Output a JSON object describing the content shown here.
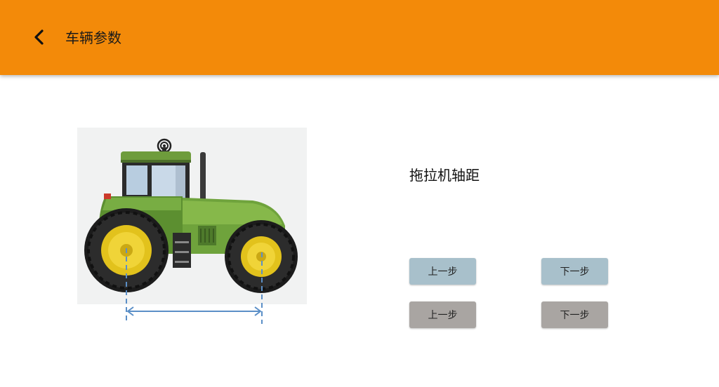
{
  "header": {
    "title": "车辆参数",
    "back_icon": "chevron-left-icon",
    "background": "#f38a09"
  },
  "illustration": {
    "subject": "tractor-wheelbase-diagram"
  },
  "main": {
    "parameter_label": "拖拉机轴距",
    "buttons": {
      "prev_primary": "上一步",
      "next_primary": "下一步",
      "prev_secondary": "上一步",
      "next_secondary": "下一步"
    },
    "colors": {
      "primary_button": "#a8c0cb",
      "secondary_button": "#a9a5a2"
    }
  }
}
